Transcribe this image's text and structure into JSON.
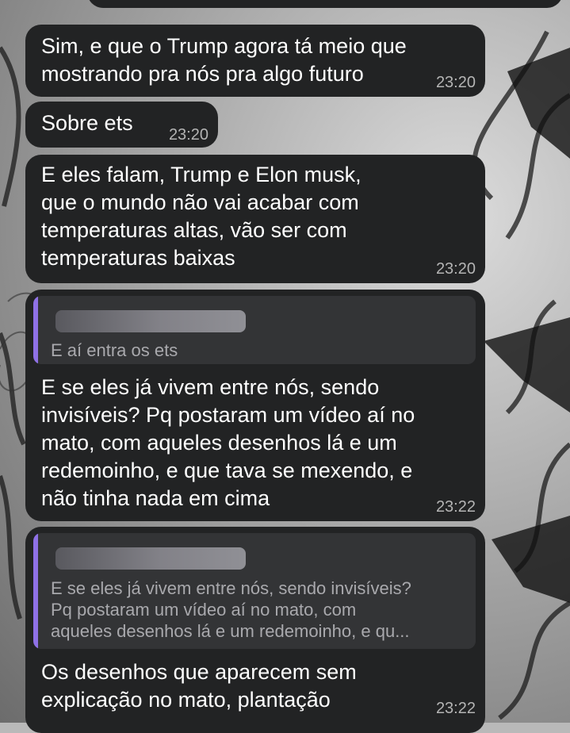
{
  "messages": [
    {
      "text": "Sim, e que o Trump agora tá meio que\nmostrando pra nós pra algo futuro",
      "time": "23:20"
    },
    {
      "text": "Sobre ets",
      "time": "23:20"
    },
    {
      "text": "E eles falam, Trump e Elon musk,\nque o mundo não vai acabar com\ntemperaturas altas, vão ser com\ntemperaturas baixas",
      "time": "23:20"
    },
    {
      "reply_quote": "E aí entra os ets",
      "text": "E se eles já vivem entre nós, sendo\ninvisíveis? Pq postaram um vídeo aí no\nmato, com aqueles desenhos lá e um\nredemoinho, e que tava se mexendo, e\nnão tinha nada em cima",
      "time": "23:22"
    },
    {
      "reply_quote": "E se eles já vivem entre nós, sendo invisíveis?\nPq postaram um vídeo aí no mato, com\naqueles desenhos lá e um redemoinho, e qu...",
      "text": "Os desenhos que aparecem sem\nexplicação no mato, plantação",
      "time": "23:22"
    }
  ],
  "colors": {
    "bubble": "#222324",
    "reply_bar": "#8f71e6",
    "timestamp": "#b4b4b4"
  }
}
